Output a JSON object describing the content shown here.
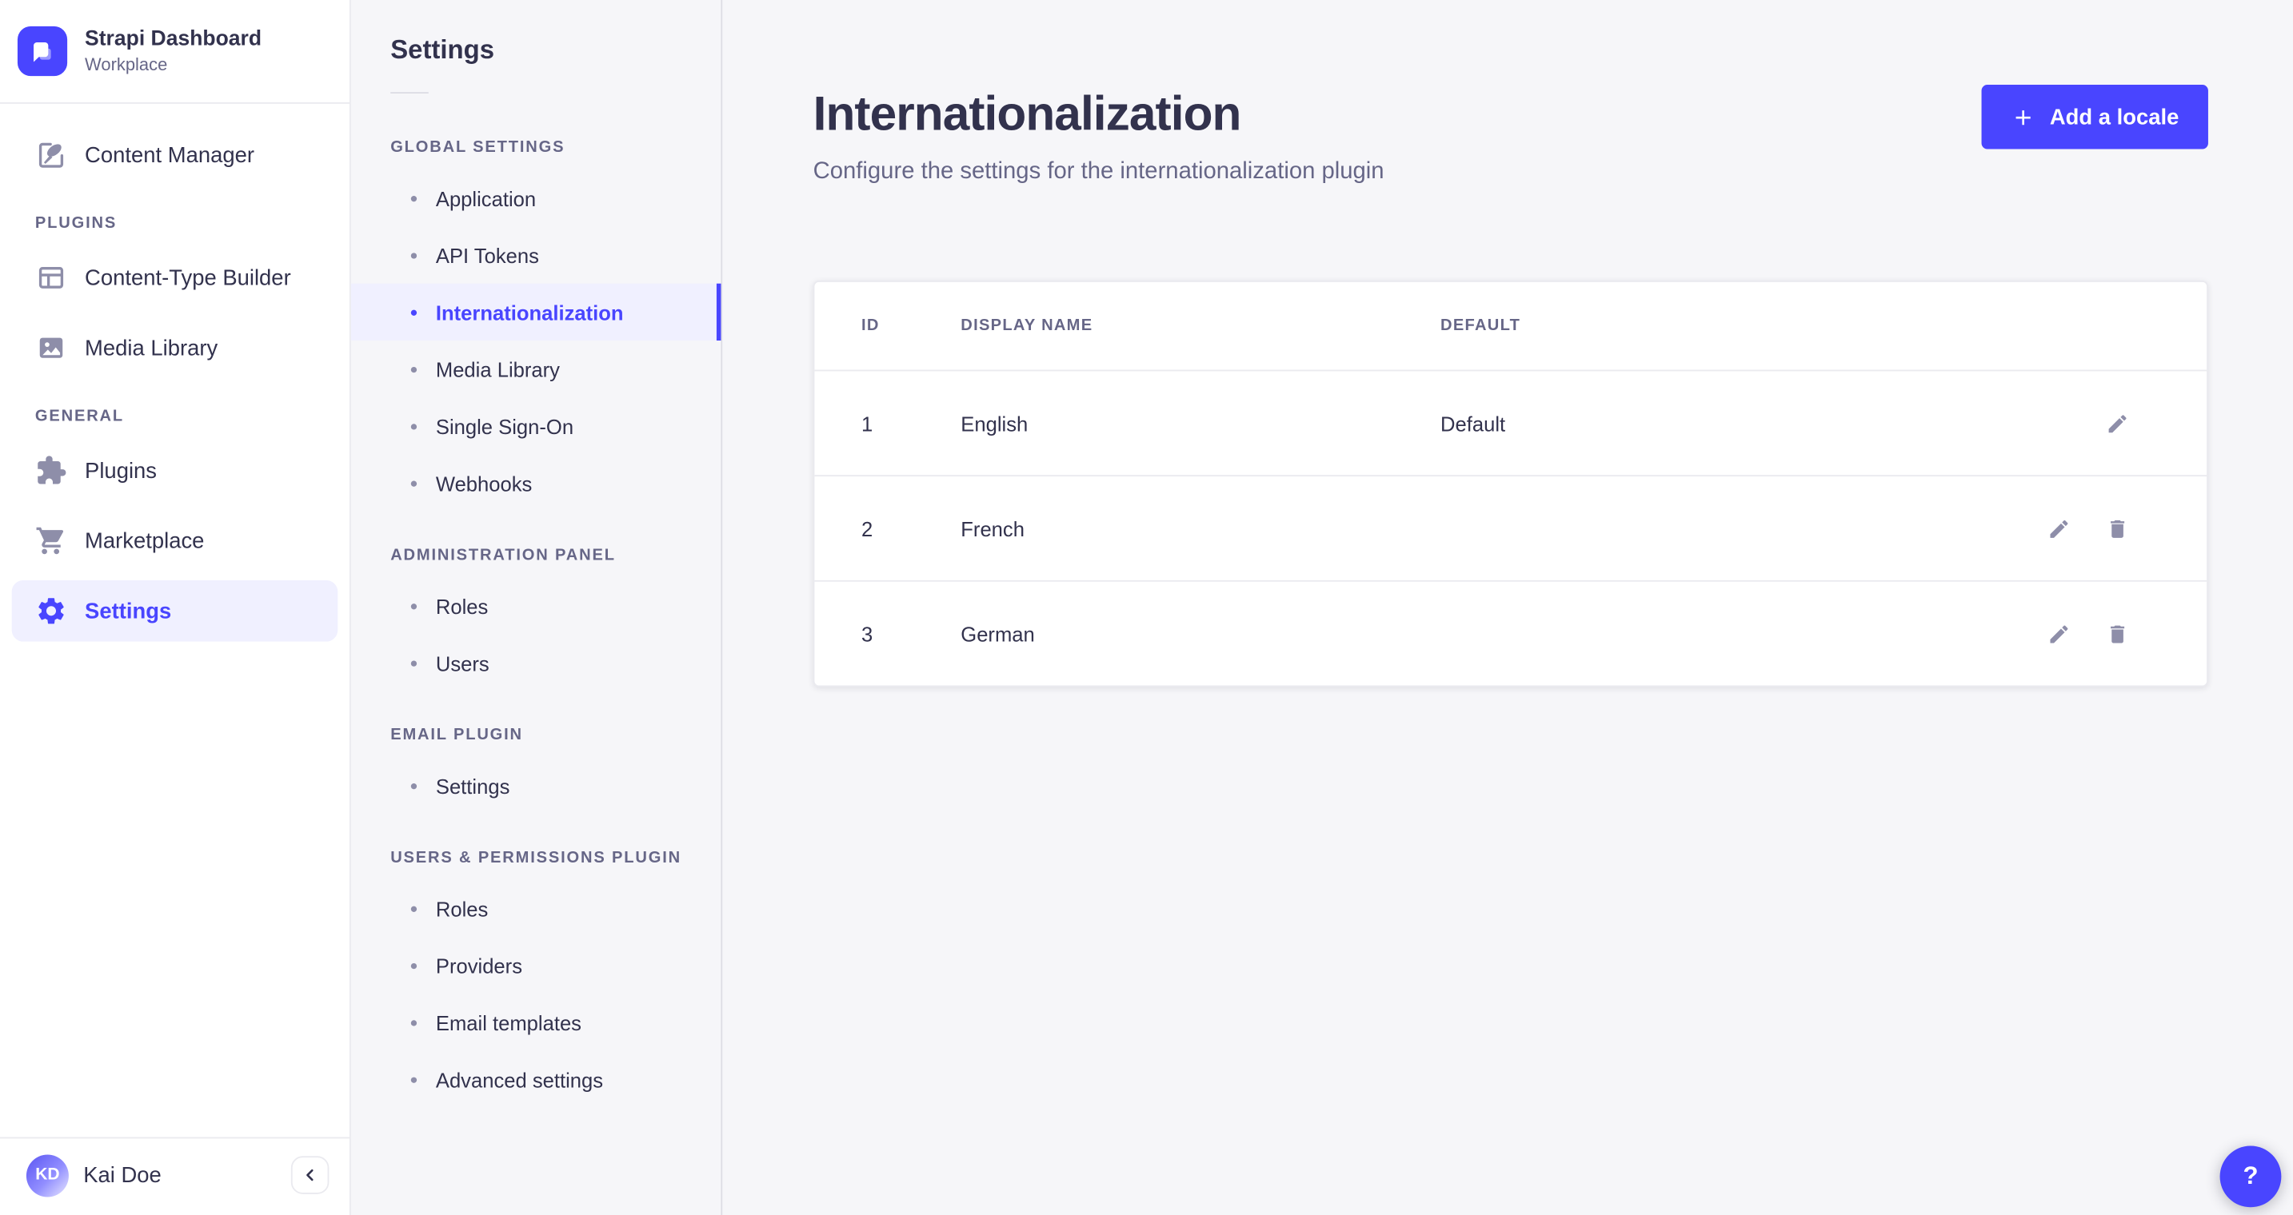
{
  "colors": {
    "primary": "#4945ff",
    "primary_light_bg": "#f0f0ff",
    "app_bg": "#f6f6f9",
    "card_bg": "#ffffff",
    "border": "#eaeaef",
    "text": "#32324d",
    "text_muted": "#666687",
    "icon_muted": "#8e8ea9"
  },
  "brand": {
    "name": "Strapi Dashboard",
    "workspace": "Workplace",
    "logo_icon": "strapi-logo-icon"
  },
  "main_nav": {
    "content_manager": {
      "label": "Content Manager",
      "icon": "content-manager-icon"
    },
    "sections": [
      {
        "label": "PLUGINS",
        "items": [
          {
            "label": "Content-Type Builder",
            "icon": "content-type-builder-icon"
          },
          {
            "label": "Media Library",
            "icon": "media-library-icon"
          }
        ]
      },
      {
        "label": "GENERAL",
        "items": [
          {
            "label": "Plugins",
            "icon": "puzzle-icon"
          },
          {
            "label": "Marketplace",
            "icon": "cart-icon"
          },
          {
            "label": "Settings",
            "icon": "gear-icon",
            "active": true
          }
        ]
      }
    ],
    "footer": {
      "user_name": "Kai Doe",
      "user_initials": "KD",
      "collapse_icon": "chevron-left-icon"
    }
  },
  "subnav": {
    "title": "Settings",
    "sections": [
      {
        "label": "GLOBAL SETTINGS",
        "items": [
          {
            "label": "Application"
          },
          {
            "label": "API Tokens"
          },
          {
            "label": "Internationalization",
            "active": true
          },
          {
            "label": "Media Library"
          },
          {
            "label": "Single Sign-On"
          },
          {
            "label": "Webhooks"
          }
        ]
      },
      {
        "label": "ADMINISTRATION PANEL",
        "items": [
          {
            "label": "Roles"
          },
          {
            "label": "Users"
          }
        ]
      },
      {
        "label": "EMAIL PLUGIN",
        "items": [
          {
            "label": "Settings"
          }
        ]
      },
      {
        "label": "USERS & PERMISSIONS PLUGIN",
        "items": [
          {
            "label": "Roles"
          },
          {
            "label": "Providers"
          },
          {
            "label": "Email templates"
          },
          {
            "label": "Advanced settings"
          }
        ]
      }
    ]
  },
  "page": {
    "title": "Internationalization",
    "subtitle": "Configure the settings for the internationalization plugin",
    "add_button_label": "Add a locale",
    "help_label": "?"
  },
  "table": {
    "headers": {
      "id": "ID",
      "display_name": "DISPLAY NAME",
      "default": "DEFAULT"
    },
    "rows": [
      {
        "id": "1",
        "display_name": "English",
        "default": "Default",
        "actions": [
          "edit"
        ]
      },
      {
        "id": "2",
        "display_name": "French",
        "default": "",
        "actions": [
          "edit",
          "delete"
        ]
      },
      {
        "id": "3",
        "display_name": "German",
        "default": "",
        "actions": [
          "edit",
          "delete"
        ]
      }
    ]
  }
}
